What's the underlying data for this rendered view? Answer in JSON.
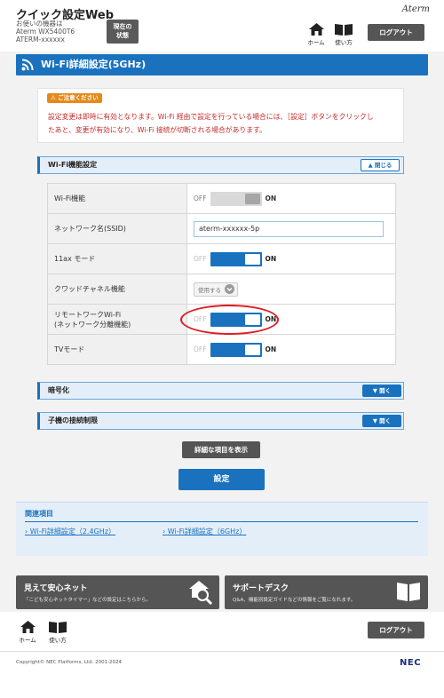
{
  "header": {
    "title": "クイック設定Web",
    "device_line1": "お使いの機器は",
    "device_line2": "Aterm WX5400T6",
    "device_line3": "ATERM-xxxxxx",
    "status_line1": "現在の",
    "status_line2": "状態",
    "brand": "Aterm",
    "home_label": "ホーム",
    "help_label": "使い方",
    "logout_label": "ログアウト"
  },
  "page": {
    "title": "Wi-Fi詳細設定(5GHz)"
  },
  "notice": {
    "badge": "ご注意ください",
    "line1": "設定変更は即時に有効となります。Wi-Fi 経由で設定を行っている場合には、［設定］ボタンをクリックし",
    "line2": "たあと、変更が有効になり、Wi-Fi 接続が切断される場合があります。"
  },
  "sections": {
    "func_title": "Wi-Fi機能設定",
    "close_label": "閉じる",
    "enc_title": "暗号化",
    "child_title": "子機の接続制限",
    "open_label": "開く"
  },
  "settings": {
    "off_text": "OFF",
    "on_text": "ON",
    "wifi_label": "Wi-Fi機能",
    "ssid_label": "ネットワーク名(SSID)",
    "ssid_value": "aterm-xxxxxx-5p",
    "ax_label": "11ax モード",
    "crowd_label": "クワッドチャネル機能",
    "crowd_value": "使用する",
    "remote_label1": "リモートワークWi-Fi",
    "remote_label2": "(ネットワーク分離機能)",
    "tv_label": "TVモード"
  },
  "buttons": {
    "detail": "詳細な項目を表示",
    "submit": "設定"
  },
  "related": {
    "title": "関連項目",
    "link_24": "Wi-Fi詳細設定（2.4GHz）",
    "link_6": "Wi-Fi詳細設定（6GHz）"
  },
  "promo": {
    "left_title": "見えて安心ネット",
    "left_sub": "「こども安心ネットタイマー」などの設定はこちらから。",
    "right_title": "サポートデスク",
    "right_sub": "Q&A、機能別設定ガイドなどの情報をご覧になれます。"
  },
  "footer": {
    "copyright": "Copyright© NEC Platforms, Ltd. 2001-2024",
    "logo": "NEC"
  },
  "colors": {
    "accent": "#1a72bf",
    "highlight": "#e01a22",
    "notice_text": "#c62828",
    "notice_badge": "#e58a1a"
  }
}
